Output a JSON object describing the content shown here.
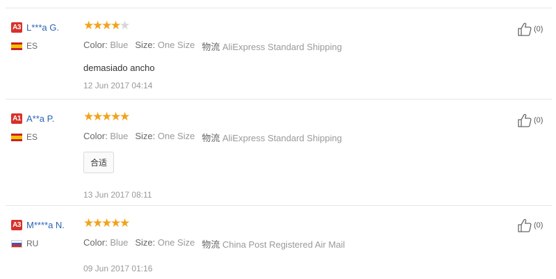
{
  "labels": {
    "color": "Color:",
    "size": "Size:",
    "shipping": "物流"
  },
  "reviews": [
    {
      "level": "A3",
      "name": "L***a G.",
      "country": "ES",
      "rating": 4,
      "color": "Blue",
      "size": "One Size",
      "shipping": "AliExpress Standard Shipping",
      "text": "demasiado ancho",
      "date": "12 Jun 2017 04:14",
      "helpful": "(0)"
    },
    {
      "level": "A1",
      "name": "A**a P.",
      "country": "ES",
      "rating": 5,
      "color": "Blue",
      "size": "One Size",
      "shipping": "AliExpress Standard Shipping",
      "text": "合适",
      "date": "13 Jun 2017 08:11",
      "helpful": "(0)"
    },
    {
      "level": "A3",
      "name": "M****a N.",
      "country": "RU",
      "rating": 5,
      "color": "Blue",
      "size": "One Size",
      "shipping": "China Post Registered Air Mail",
      "date": "09 Jun 2017 01:16",
      "helpful": "(0)"
    }
  ],
  "colors": {
    "star": "#f2a21b",
    "name_link": "#2a63b5",
    "level_badge": "#d6322b"
  }
}
